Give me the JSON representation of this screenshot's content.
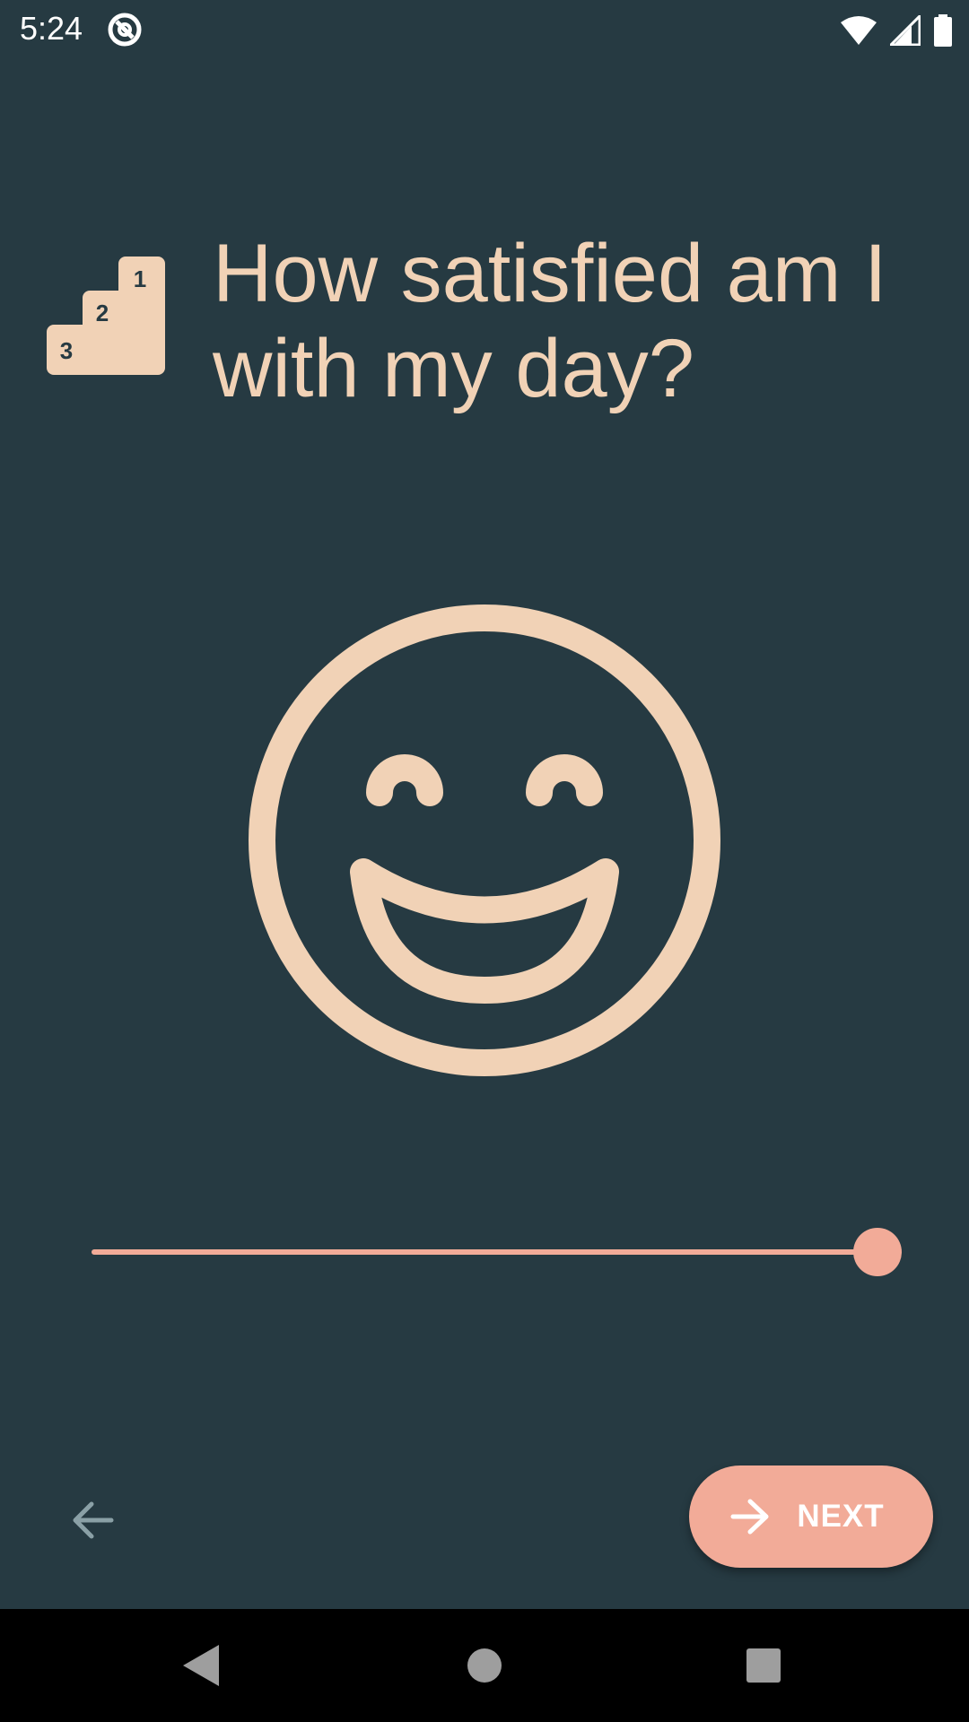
{
  "status_bar": {
    "time": "5:24",
    "app_icon": "assistant-icon",
    "wifi_icon": "wifi-icon",
    "signal_icon": "cell-signal-icon",
    "battery_icon": "battery-icon"
  },
  "question": {
    "icon": "podium-icon",
    "podium_numbers": [
      "1",
      "2",
      "3"
    ],
    "text": "How satisfied am I with my day?"
  },
  "mood": {
    "icon": "laughing-face-icon"
  },
  "slider": {
    "value_fraction": 1.0
  },
  "actions": {
    "back_icon": "arrow-left-icon",
    "next_icon": "arrow-right-icon",
    "next_label": "NEXT"
  },
  "nav_bar": {
    "back_icon": "nav-back-icon",
    "home_icon": "nav-home-icon",
    "recents_icon": "nav-recents-icon"
  },
  "colors": {
    "background": "#263a42",
    "accent": "#f1d2b6",
    "button": "#f2ab98"
  }
}
